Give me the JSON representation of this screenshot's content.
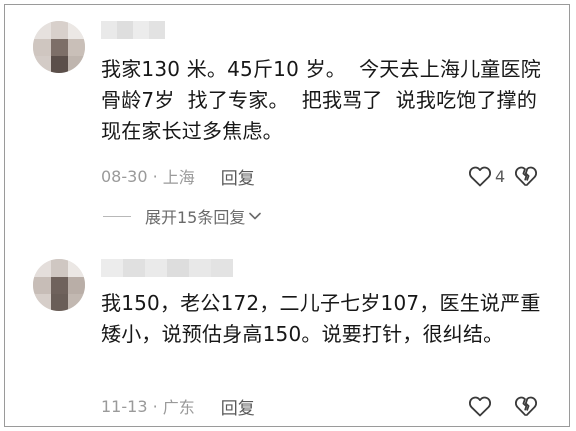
{
  "comments": [
    {
      "text": "我家130 米。45斤10 岁。  今天去上海儿童医院  骨龄7岁  找了专家。  把我骂了  说我吃饱了撑的  现在家长过多焦虑。",
      "date": "08-30",
      "location": "上海",
      "reply_label": "回复",
      "like_count": "4",
      "icons": {
        "like": "heart-outline-icon",
        "dislike": "broken-heart-icon"
      }
    },
    {
      "text": "我150，老公172，二儿子七岁107，医生说严重矮小，说预估身高150。说要打针，很纠结。",
      "date": "11-13",
      "location": "广东",
      "reply_label": "回复",
      "like_count": "",
      "icons": {
        "like": "heart-outline-icon",
        "dislike": "broken-heart-icon"
      }
    }
  ],
  "expand_replies_label": "展开15条回复",
  "colors": {
    "text": "#171717",
    "meta": "#9a9a9a",
    "border": "#9a9a9a",
    "icon": "#3a3a3a"
  }
}
